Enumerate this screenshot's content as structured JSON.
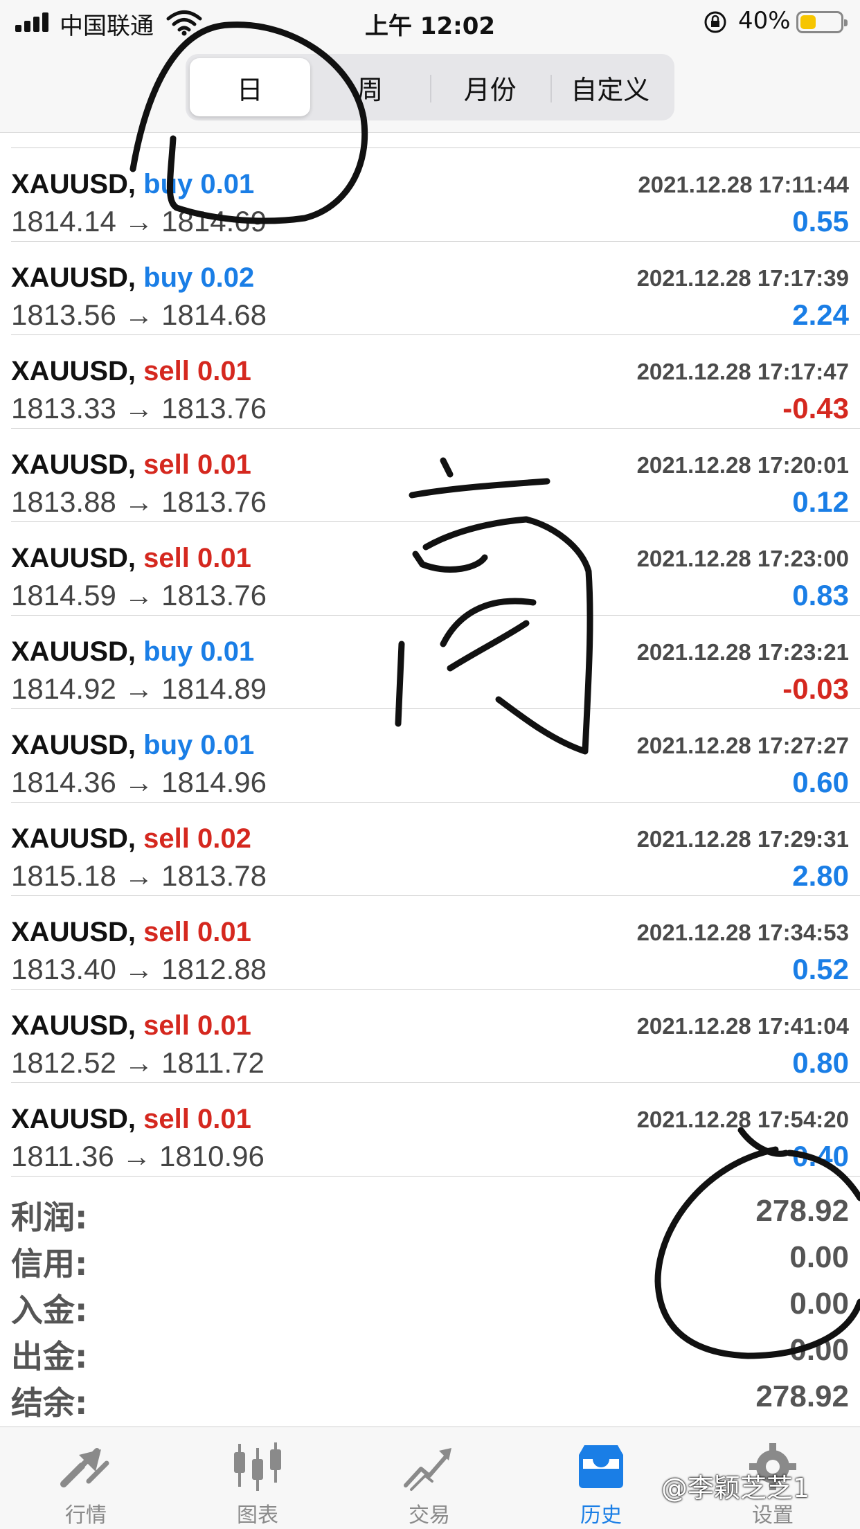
{
  "status_bar": {
    "carrier": "中国联通",
    "time": "上午 12:02",
    "battery_percent": "40%",
    "battery_level": 0.4,
    "battery_color": "#f6c500",
    "icons": [
      "signal-icon",
      "wifi-icon",
      "orientation-lock-icon",
      "battery-icon"
    ]
  },
  "period_tabs": {
    "items": [
      "日",
      "周",
      "月份",
      "自定义"
    ],
    "selected": "日"
  },
  "trades": [
    {
      "symbol": "XAUUSD,",
      "side": "buy",
      "volume": "0.01",
      "time": "2021.12.28 17:11:44",
      "prices": "1814.14 → 1814.69",
      "profit": "0.55"
    },
    {
      "symbol": "XAUUSD,",
      "side": "buy",
      "volume": "0.02",
      "time": "2021.12.28 17:17:39",
      "prices": "1813.56 → 1814.68",
      "profit": "2.24"
    },
    {
      "symbol": "XAUUSD,",
      "side": "sell",
      "volume": "0.01",
      "time": "2021.12.28 17:17:47",
      "prices": "1813.33 → 1813.76",
      "profit": "-0.43"
    },
    {
      "symbol": "XAUUSD,",
      "side": "sell",
      "volume": "0.01",
      "time": "2021.12.28 17:20:01",
      "prices": "1813.88 → 1813.76",
      "profit": "0.12"
    },
    {
      "symbol": "XAUUSD,",
      "side": "sell",
      "volume": "0.01",
      "time": "2021.12.28 17:23:00",
      "prices": "1814.59 → 1813.76",
      "profit": "0.83"
    },
    {
      "symbol": "XAUUSD,",
      "side": "buy",
      "volume": "0.01",
      "time": "2021.12.28 17:23:21",
      "prices": "1814.92 → 1814.89",
      "profit": "-0.03"
    },
    {
      "symbol": "XAUUSD,",
      "side": "buy",
      "volume": "0.01",
      "time": "2021.12.28 17:27:27",
      "prices": "1814.36 → 1814.96",
      "profit": "0.60"
    },
    {
      "symbol": "XAUUSD,",
      "side": "sell",
      "volume": "0.02",
      "time": "2021.12.28 17:29:31",
      "prices": "1815.18 → 1813.78",
      "profit": "2.80"
    },
    {
      "symbol": "XAUUSD,",
      "side": "sell",
      "volume": "0.01",
      "time": "2021.12.28 17:34:53",
      "prices": "1813.40 → 1812.88",
      "profit": "0.52"
    },
    {
      "symbol": "XAUUSD,",
      "side": "sell",
      "volume": "0.01",
      "time": "2021.12.28 17:41:04",
      "prices": "1812.52 → 1811.72",
      "profit": "0.80"
    },
    {
      "symbol": "XAUUSD,",
      "side": "sell",
      "volume": "0.01",
      "time": "2021.12.28 17:54:20",
      "prices": "1811.36 → 1810.96",
      "profit": "0.40"
    }
  ],
  "summary": [
    {
      "label": "利润:",
      "value": "278.92"
    },
    {
      "label": "信用:",
      "value": "0.00"
    },
    {
      "label": "入金:",
      "value": "0.00"
    },
    {
      "label": "出金:",
      "value": "0.00"
    },
    {
      "label": "结余:",
      "value": "278.92"
    }
  ],
  "tabbar": [
    {
      "label": "行情",
      "icon": "quotes-icon",
      "active": false
    },
    {
      "label": "图表",
      "icon": "chart-icon",
      "active": false
    },
    {
      "label": "交易",
      "icon": "trade-icon",
      "active": false
    },
    {
      "label": "历史",
      "icon": "history-icon",
      "active": true
    },
    {
      "label": "设置",
      "icon": "settings-icon",
      "active": false
    }
  ],
  "watermark": "@李颖芝芝1",
  "colors": {
    "buy": "#1a7ee6",
    "sell": "#d5281f",
    "active_tab": "#1a7ee6"
  }
}
